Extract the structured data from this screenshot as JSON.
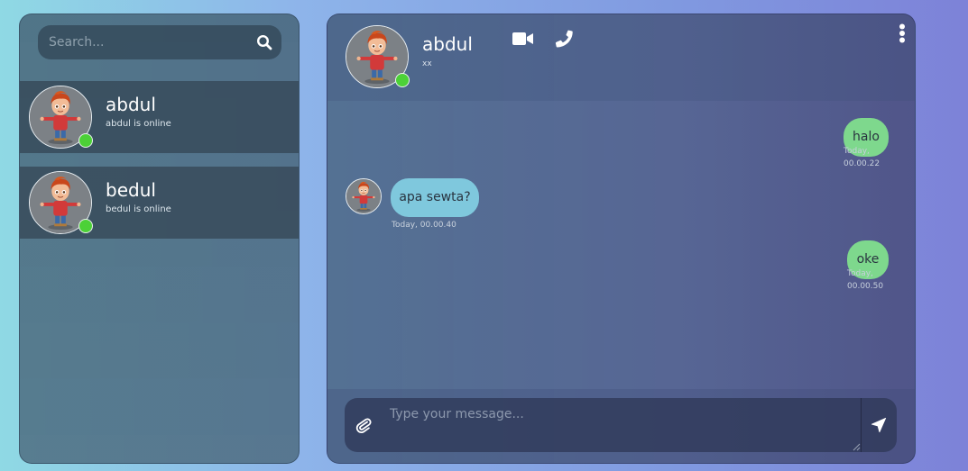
{
  "search": {
    "placeholder": "Search..."
  },
  "contacts": [
    {
      "name": "abdul",
      "status": "abdul is online"
    },
    {
      "name": "bedul",
      "status": "bedul is online"
    }
  ],
  "chat": {
    "name": "abdul",
    "subtitle": "xx",
    "messages": [
      {
        "direction": "out",
        "text": "halo",
        "time_line1": "Today,",
        "time_line2": "00.00.22"
      },
      {
        "direction": "in",
        "text": "apa sewta?",
        "time": "Today, 00.00.40"
      },
      {
        "direction": "out",
        "text": "oke",
        "time_line1": "Today,",
        "time_line2": "00.00.50"
      }
    ],
    "input_placeholder": "Type your message..."
  },
  "colors": {
    "online": "#4cd137",
    "outgoing_bubble": "#7ed88d",
    "incoming_bubble": "#7fc8dd"
  },
  "icons": {
    "search": "search-icon",
    "video": "video-camera-icon",
    "phone": "phone-icon",
    "menu": "kebab-menu-icon",
    "attach": "paperclip-icon",
    "send": "send-location-arrow-icon"
  }
}
